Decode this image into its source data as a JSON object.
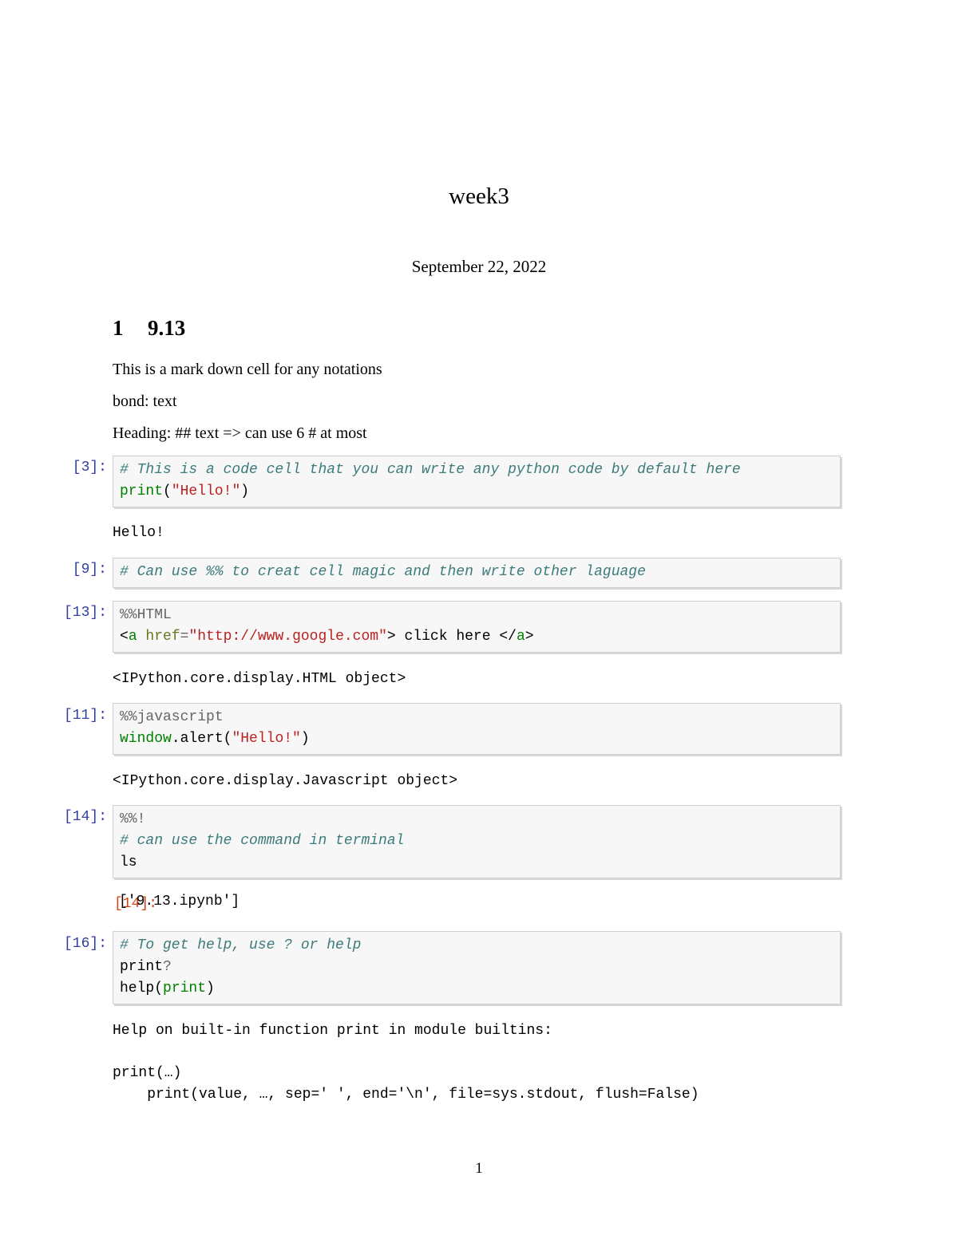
{
  "document": {
    "title": "week3",
    "date": "September 22, 2022",
    "page_number": "1"
  },
  "section": {
    "number": "1",
    "title": "9.13"
  },
  "markdown": [
    "This is a mark down cell for any notations",
    "bond: text",
    "Heading: ## text => can use 6 # at most"
  ],
  "colors": {
    "input_prompt": "#303F9F",
    "output_prompt": "#D84315",
    "comment": "#3D7B7B",
    "builtin": "#008000",
    "string": "#BA2121",
    "cell_background": "#f7f7f7"
  },
  "cells": [
    {
      "prompt": "[3]:",
      "lines": {
        "l1_comment": "# This is a code cell that you can write any python code by default here",
        "l2_builtin": "print",
        "l2_open": "(",
        "l2_str": "\"Hello!\"",
        "l2_close": ")"
      },
      "output": "Hello!"
    },
    {
      "prompt": "[9]:",
      "lines": {
        "l1_comment": "# Can use %% to creat cell magic and then write other laguage"
      }
    },
    {
      "prompt": "[13]:",
      "lines": {
        "l1_magic": "%%HTML",
        "l2_lt": "<",
        "l2_tag": "a",
        "l2_attr": " href",
        "l2_eq": "=",
        "l2_str": "\"http://www.google.com\"",
        "l2_gt": ">",
        "l2_text": " click here ",
        "l2_close_lt": "</",
        "l2_close_tag": "a",
        "l2_close_gt": ">"
      },
      "output": "<IPython.core.display.HTML object>"
    },
    {
      "prompt": "[11]:",
      "lines": {
        "l1_magic": "%%javascript",
        "l2_builtin": "window",
        "l2_rest": ".alert(",
        "l2_str": "\"Hello!\"",
        "l2_close": ")"
      },
      "output": "<IPython.core.display.Javascript object>"
    },
    {
      "prompt": "[14]:",
      "lines": {
        "l1_magic": "%%!",
        "l2_comment": "# can use the command in terminal",
        "l3": "ls"
      },
      "output_prompt": "[14]:",
      "output": "['9.13.ipynb']"
    },
    {
      "prompt": "[16]:",
      "lines": {
        "l1_comment": "# To get help, use ? or help",
        "l2_name": "print",
        "l2_op": "?",
        "l3_name": "help(",
        "l3_builtin": "print",
        "l3_close": ")"
      },
      "output_lines": [
        "Help on built-in function print in module builtins:",
        "",
        "print(…)",
        "    print(value, …, sep=' ', end='\\n', file=sys.stdout, flush=False)"
      ]
    }
  ]
}
